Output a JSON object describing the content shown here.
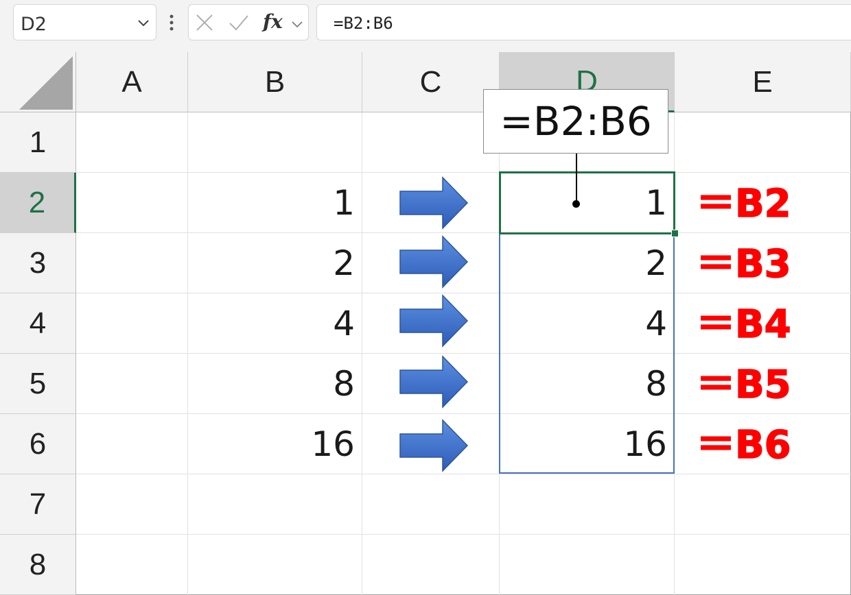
{
  "namebox": {
    "value": "D2"
  },
  "formula_bar": {
    "fx_label": "fx",
    "formula": "=B2:B6"
  },
  "columns": [
    "A",
    "B",
    "C",
    "D",
    "E"
  ],
  "rows": [
    "1",
    "2",
    "3",
    "4",
    "5",
    "6",
    "7",
    "8"
  ],
  "selected": {
    "column": "D",
    "row": "2"
  },
  "cells": {
    "B2": "1",
    "B3": "2",
    "B4": "4",
    "B5": "8",
    "B6": "16",
    "D2": "1",
    "D3": "2",
    "D4": "4",
    "D5": "8",
    "D6": "16"
  },
  "callout": {
    "text": "=B2:B6"
  },
  "annotations": [
    "＝B2",
    "＝B3",
    "＝B4",
    "＝B5",
    "＝B6"
  ],
  "colors": {
    "annotation": "#ff0000",
    "arrow": "#4472c4",
    "selection": "#1e7145"
  }
}
